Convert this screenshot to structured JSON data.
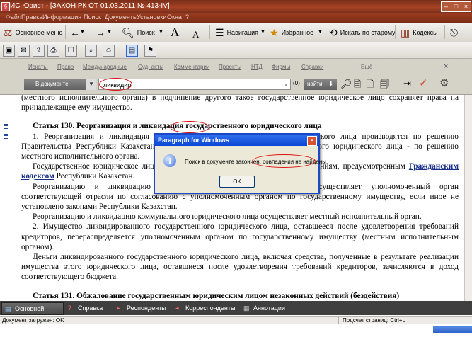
{
  "window": {
    "title": "ИС Юрист - [ЗАКОН РК ОТ 01.03.2011 № 413-IV]"
  },
  "menu": [
    "Файл",
    "Правка",
    "Информация",
    "Поиск",
    "Документы",
    "Установки",
    "Окна",
    "?"
  ],
  "toolbar": {
    "main_menu": "Основное меню",
    "search": "Поиск",
    "navigation": "Навигация",
    "favorites": "Избранное",
    "search_old": "Искать по старому",
    "codes": "Кодексы"
  },
  "search_panel": {
    "search_label": "Искать:",
    "tabs": [
      "Право",
      "Международные",
      "Суд. акты",
      "Комментарии",
      "Проекты",
      "НТД",
      "Фирмы",
      "Справки",
      "Ещё"
    ],
    "scope": "В документе",
    "query": "ликвидир",
    "count": "(0)",
    "find_button": "найти"
  },
  "document": {
    "p0": "(местного исполнительного органа) в подчинение другого такое государственное юридическое лицо сохраняет права на принадлежащее ему имущество.",
    "heading1": "Статья 130. Реорганизация и ликвидация государственного юридического лица",
    "p1": "1. Реорганизация и ликвидация республиканского государственного юридического лица производятся по решению Правительства Республики Казахстан, а реорганизация и ликвидация коммунального юридического лица - по решению местного исполнительного органа.",
    "p2a": "Государственное юридическое лицо может быть ликвидировано по иным основаниям, предусмотренным",
    "p2link": "Гражданским кодексом",
    "p2b": "Республики Казахстан.",
    "p3": "Реорганизацию и ликвидацию республиканского юридического лица осуществляет уполномоченный орган соответствующей отрасли по согласованию с уполномоченным органом по государственному имуществу, если иное не установлено законами Республики Казахстан.",
    "p4": "Реорганизацию и ликвидацию коммунального юридического лица осуществляет местный исполнительный орган.",
    "p5": "2. Имущество ликвидированного государственного юридического лица, оставшееся после удовлетворения требований кредиторов, перераспределяется уполномоченным органом по государственному имуществу (местным исполнительным органом).",
    "p6": "Деньги ликвидированного государственного юридического лица, включая средства, полученные в результате реализации имущества этого юридического лица, оставшиеся после удовлетворения требований кредиторов, зачисляются в доход соответствующего бюджета.",
    "heading2": "Статья 131. Обжалование государственным юридическим лицом незаконных действий (бездействия)"
  },
  "bottom_tabs": [
    "Основной",
    "Справка",
    "Респонденты",
    "Корреспонденты",
    "Аннотации"
  ],
  "status": {
    "left": "Документ загружен: OK",
    "right": "Подсчет страниц: Ctrl+L"
  },
  "dialog": {
    "title": "Paragraph for Windows",
    "message": "Поиск в документе закончен. совпадения не найдены.",
    "ok": "OK"
  }
}
